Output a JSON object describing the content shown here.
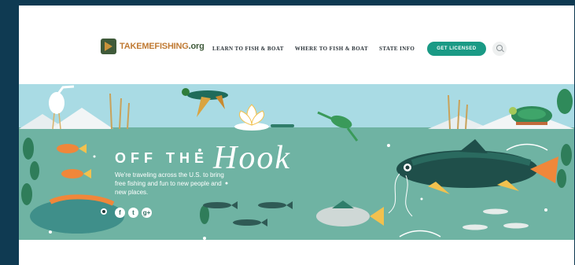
{
  "header": {
    "logo": {
      "main": "TAKEMEFISHING",
      "suffix": ".org"
    },
    "nav": [
      {
        "label": "LEARN TO FISH & BOAT"
      },
      {
        "label": "WHERE TO FISH & BOAT"
      },
      {
        "label": "STATE INFO"
      }
    ],
    "cta_label": "GET LICENSED",
    "search_icon": "search-icon"
  },
  "hero": {
    "title_prefix": "OFF THE",
    "title_script": "Hook",
    "description": "We're traveling across the U.S. to bring free fishing and fun to new people and new places.",
    "social": [
      {
        "icon": "facebook-icon",
        "glyph": "f"
      },
      {
        "icon": "twitter-icon",
        "glyph": "t"
      },
      {
        "icon": "google-plus-icon",
        "glyph": "g+"
      }
    ]
  },
  "colors": {
    "frame": "#0f3a52",
    "sky": "#a9dbe4",
    "water": "#6fb3a3",
    "accent": "#1a9a85",
    "logo_orange": "#c07a33",
    "logo_green": "#3f5a3a"
  }
}
